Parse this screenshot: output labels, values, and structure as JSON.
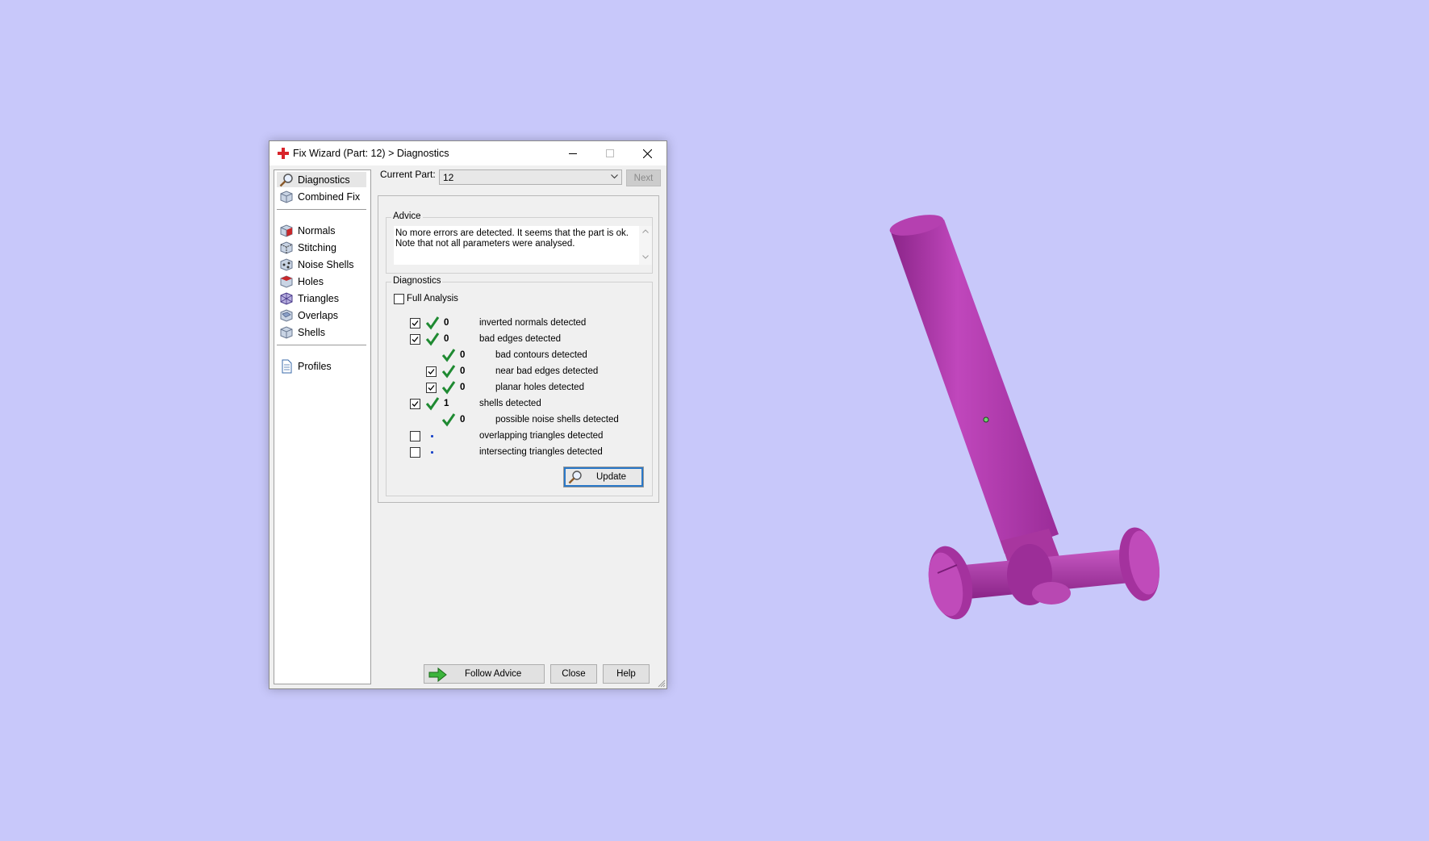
{
  "window": {
    "title": "Fix Wizard (Part: 12) > Diagnostics",
    "icon": "red-cross-icon",
    "controls": [
      "minimize-icon",
      "maximize-icon",
      "close-icon"
    ]
  },
  "sidebar": {
    "items": [
      {
        "label": "Diagnostics",
        "icon": "magnifier-icon",
        "selected": true
      },
      {
        "label": "Combined Fix",
        "icon": "cube-icon"
      },
      {
        "label": "Normals",
        "icon": "normals-cube-icon"
      },
      {
        "label": "Stitching",
        "icon": "stitching-cube-icon"
      },
      {
        "label": "Noise Shells",
        "icon": "noise-shells-cube-icon"
      },
      {
        "label": "Holes",
        "icon": "holes-cube-icon"
      },
      {
        "label": "Triangles",
        "icon": "triangles-cube-icon"
      },
      {
        "label": "Overlaps",
        "icon": "overlaps-cube-icon"
      },
      {
        "label": "Shells",
        "icon": "shells-cube-icon"
      },
      {
        "label": "Profiles",
        "icon": "document-icon"
      }
    ]
  },
  "header": {
    "current_part_label": "Current Part:",
    "current_part_value": "12",
    "next_label": "Next"
  },
  "advice": {
    "title": "Advice",
    "line1": "No more errors are detected. It seems that the part is ok.",
    "line2": "Note that not all parameters were analysed."
  },
  "diagnostics": {
    "title": "Diagnostics",
    "full_analysis_label": "Full Analysis",
    "full_analysis_checked": false,
    "rows": [
      {
        "checkbox": true,
        "checked": true,
        "status": "ok",
        "count": "0",
        "label": "inverted normals detected",
        "indent": 0
      },
      {
        "checkbox": true,
        "checked": true,
        "status": "ok",
        "count": "0",
        "label": "bad edges detected",
        "indent": 0
      },
      {
        "checkbox": false,
        "checked": false,
        "status": "ok",
        "count": "0",
        "label": "bad contours detected",
        "indent": 1
      },
      {
        "checkbox": true,
        "checked": true,
        "status": "ok",
        "count": "0",
        "label": "near bad edges detected",
        "indent": 1
      },
      {
        "checkbox": true,
        "checked": true,
        "status": "ok",
        "count": "0",
        "label": "planar holes detected",
        "indent": 1
      },
      {
        "checkbox": true,
        "checked": true,
        "status": "ok",
        "count": "1",
        "label": "shells detected",
        "indent": 0
      },
      {
        "checkbox": false,
        "checked": false,
        "status": "ok",
        "count": "0",
        "label": "possible noise shells detected",
        "indent": 1
      },
      {
        "checkbox": true,
        "checked": false,
        "status": "pending",
        "count": "",
        "label": "overlapping triangles detected",
        "indent": 0
      },
      {
        "checkbox": true,
        "checked": false,
        "status": "pending",
        "count": "",
        "label": "intersecting triangles detected",
        "indent": 0
      }
    ],
    "update_label": "Update"
  },
  "footer": {
    "follow_advice_label": "Follow Advice",
    "close_label": "Close",
    "help_label": "Help"
  },
  "colors": {
    "desktop": "#c8c8fa",
    "model": "#b03aaa",
    "check": "#1f8a32",
    "focus": "#2a78c8"
  }
}
